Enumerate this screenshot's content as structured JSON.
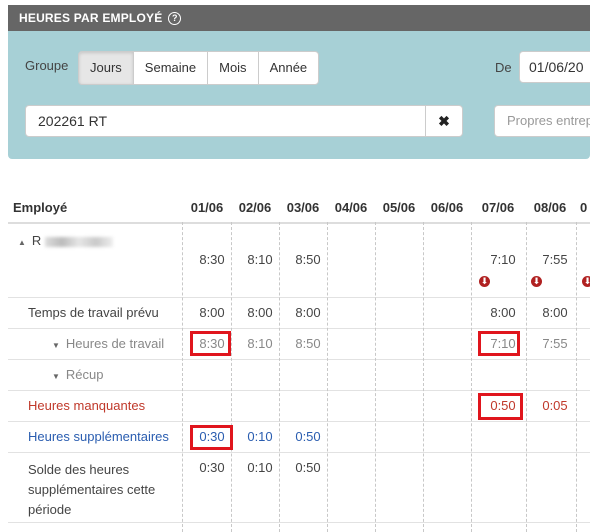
{
  "header": {
    "title": "HEURES PAR EMPLOYÉ",
    "help_icon": "help-circle-icon"
  },
  "filters": {
    "group_label": "Groupe",
    "group_options": [
      "Jours",
      "Semaine",
      "Mois",
      "Année"
    ],
    "group_selected": "Jours",
    "from_label": "De",
    "from_value": "01/06/20",
    "search_value": "202261 RT",
    "clear_icon": "close-icon",
    "company_placeholder": "Propres entrep"
  },
  "table": {
    "employee_header": "Employé",
    "dates": [
      "01/06",
      "02/06",
      "03/06",
      "04/06",
      "05/06",
      "06/06",
      "07/06",
      "08/06",
      "0"
    ],
    "employee_name": "R",
    "totals": [
      "8:30",
      "8:10",
      "8:50",
      "",
      "",
      "",
      "7:10",
      "7:55"
    ],
    "rows": {
      "planned": {
        "label": "Temps de travail prévu",
        "values": [
          "8:00",
          "8:00",
          "8:00",
          "",
          "",
          "",
          "8:00",
          "8:00"
        ]
      },
      "worked": {
        "label": "Heures de travail",
        "values": [
          "8:30",
          "8:10",
          "8:50",
          "",
          "",
          "",
          "7:10",
          "7:55"
        ]
      },
      "recup": {
        "label": "Récup"
      },
      "missing": {
        "label": "Heures manquantes",
        "values": [
          "",
          "",
          "",
          "",
          "",
          "",
          "0:50",
          "0:05"
        ]
      },
      "overtime": {
        "label": "Heures supplémentaires",
        "values": [
          "0:30",
          "0:10",
          "0:50"
        ]
      },
      "balance": {
        "label_line1": "Solde des heures",
        "label_line2": "supplémentaires cette",
        "label_line3": "période",
        "values": [
          "0:30",
          "0:10",
          "0:50"
        ]
      }
    }
  },
  "colors": {
    "header_bg": "#666666",
    "panel_bg": "#a7d0d6",
    "missing": "#c0392b",
    "overtime": "#2a5db0",
    "highlight": "#e0151d"
  }
}
